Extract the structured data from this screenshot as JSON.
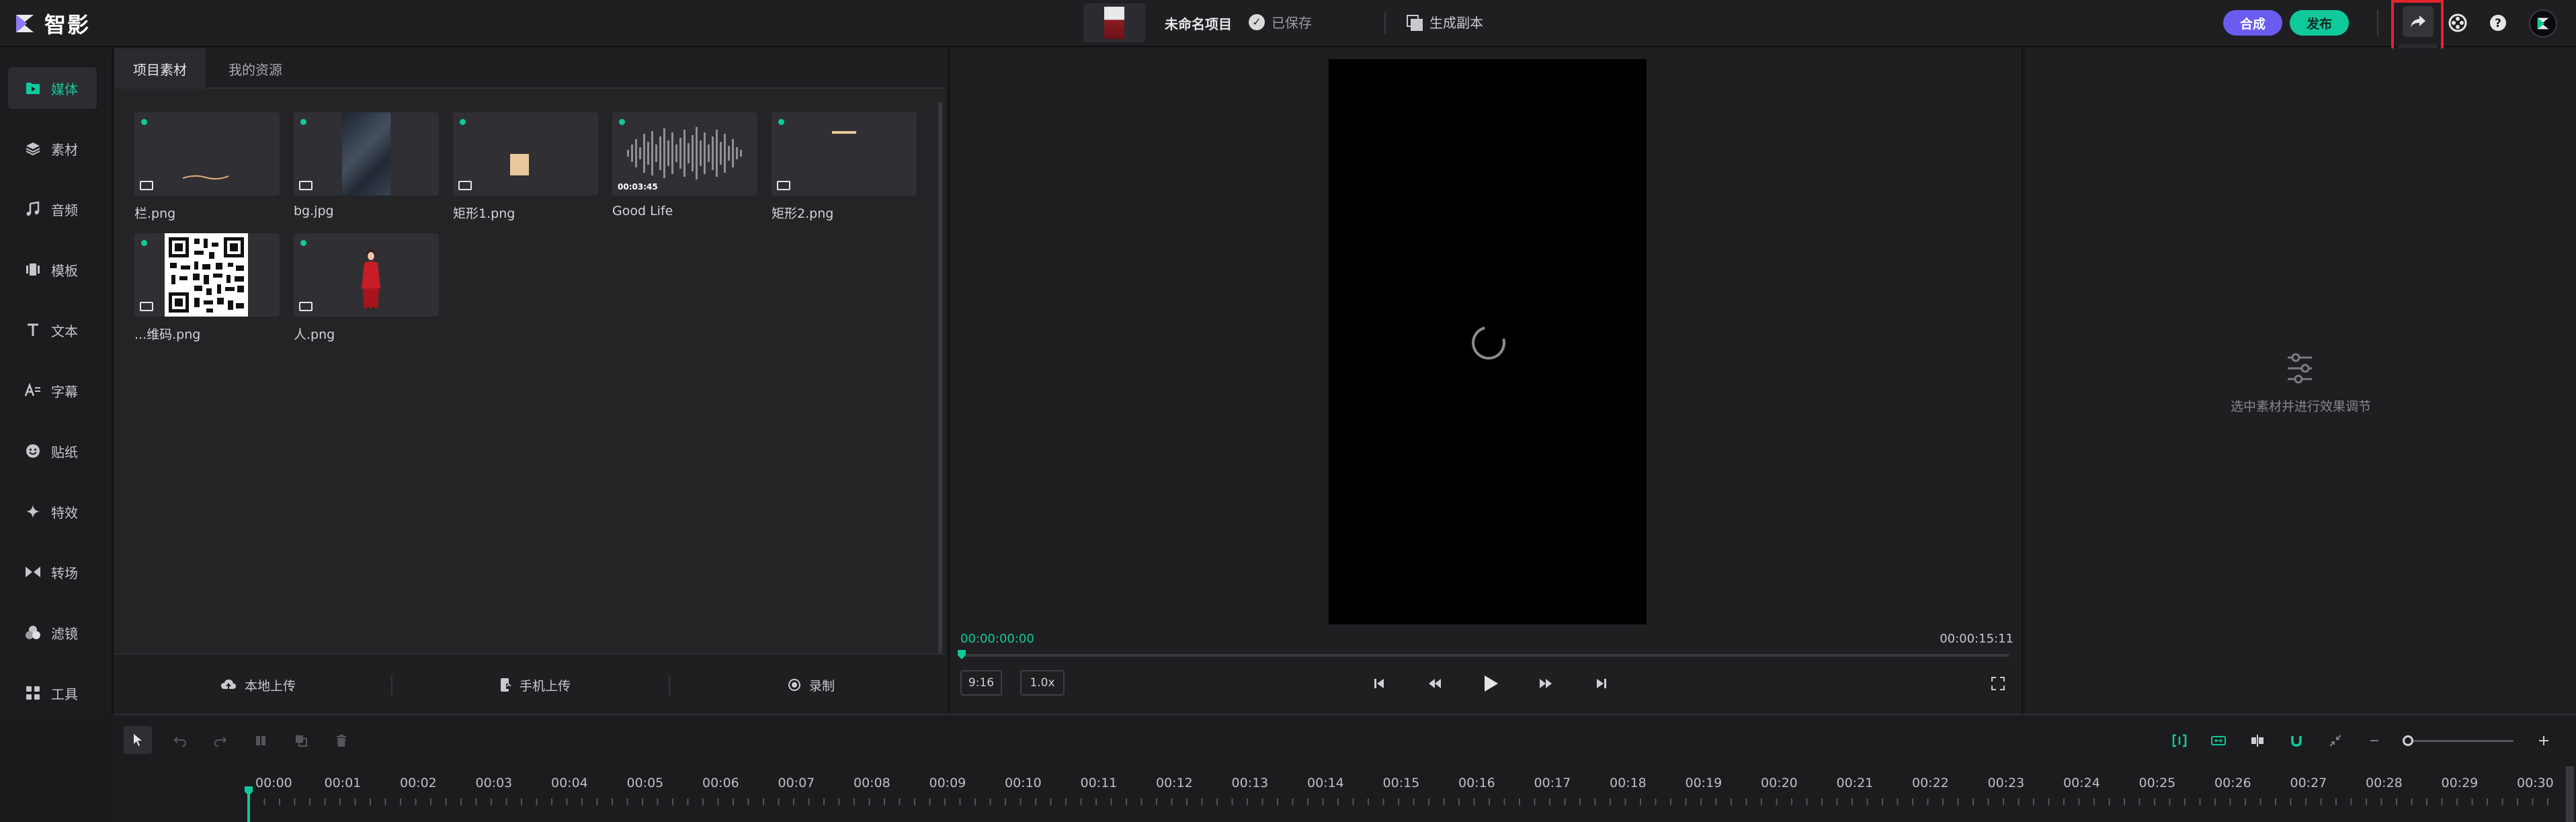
{
  "app": {
    "name": "智影"
  },
  "project": {
    "title": "未命名项目",
    "saved_status": "已保存",
    "generate_copy": "生成副本"
  },
  "header": {
    "compose_label": "合成",
    "publish_label": "发布",
    "share_tooltip": "分享",
    "icons": [
      "share-icon",
      "film-reel-icon",
      "help-icon",
      "avatar"
    ]
  },
  "colors": {
    "accent": "#10c99a",
    "compose": "#6b5cf0",
    "highlight": "#e5232f"
  },
  "nav": {
    "items": [
      {
        "label": "媒体",
        "icon": "media-icon",
        "active": true
      },
      {
        "label": "素材",
        "icon": "layers-icon"
      },
      {
        "label": "音频",
        "icon": "music-icon"
      },
      {
        "label": "模板",
        "icon": "template-icon"
      },
      {
        "label": "文本",
        "icon": "text-icon"
      },
      {
        "label": "字幕",
        "icon": "subtitle-icon"
      },
      {
        "label": "贴纸",
        "icon": "sticker-icon"
      },
      {
        "label": "特效",
        "icon": "sparkle-icon"
      },
      {
        "label": "转场",
        "icon": "transition-icon"
      },
      {
        "label": "滤镜",
        "icon": "filter-icon"
      },
      {
        "label": "工具",
        "icon": "tools-icon"
      }
    ]
  },
  "media": {
    "tabs": [
      {
        "label": "项目素材",
        "active": true
      },
      {
        "label": "我的资源"
      }
    ],
    "assets": [
      {
        "name": "栏.png",
        "kind": "image"
      },
      {
        "name": "bg.jpg",
        "kind": "image"
      },
      {
        "name": "矩形1.png",
        "kind": "image"
      },
      {
        "name": "Good Life",
        "kind": "audio",
        "duration": "00:03:45"
      },
      {
        "name": "矩形2.png",
        "kind": "image"
      },
      {
        "name": "...维码.png",
        "kind": "image"
      },
      {
        "name": "人.png",
        "kind": "image"
      }
    ],
    "upload": {
      "local": "本地上传",
      "phone": "手机上传",
      "record": "录制"
    }
  },
  "preview": {
    "current_time": "00:00:00:00",
    "total_time": "00:00:15:11",
    "aspect": "9:16",
    "speed": "1.0x",
    "progress": 0
  },
  "properties": {
    "hint": "选中素材并进行效果调节"
  },
  "timeline": {
    "ticks": [
      "00:00",
      "00:01",
      "00:02",
      "00:03",
      "00:04",
      "00:05",
      "00:06",
      "00:07",
      "00:08",
      "00:09",
      "00:10",
      "00:11",
      "00:12",
      "00:13",
      "00:14",
      "00:15",
      "00:16",
      "00:17",
      "00:18",
      "00:19",
      "00:20",
      "00:21",
      "00:22",
      "00:23",
      "00:24",
      "00:25",
      "00:26",
      "00:27",
      "00:28",
      "00:29",
      "00:30"
    ]
  }
}
